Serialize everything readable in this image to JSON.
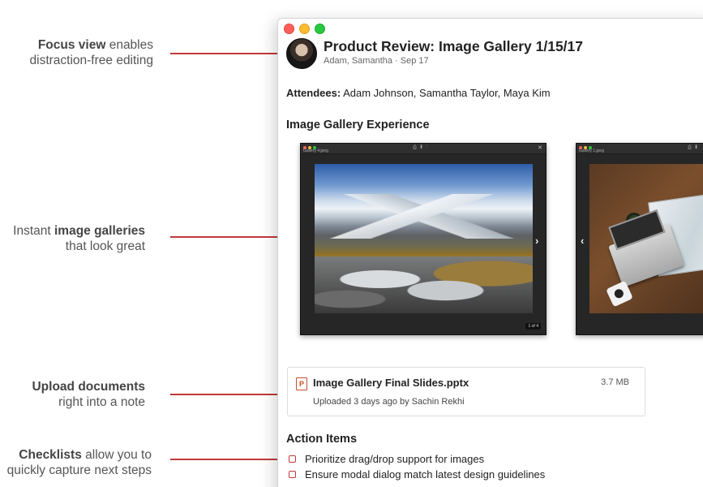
{
  "callouts": [
    {
      "bold": "Focus view",
      "rest1": " enables",
      "line2": "distraction-free editing"
    },
    {
      "pre": "Instant ",
      "bold": "image galleries",
      "line2": "that look great"
    },
    {
      "bold": "Upload documents",
      "line2": "right into a note"
    },
    {
      "bold": "Checklists",
      "rest1": " allow you to",
      "line2": "quickly capture next steps"
    }
  ],
  "colors": {
    "accent": "#c0393b",
    "traffic_red": "#fc5f57",
    "traffic_yellow": "#fdbc2e",
    "traffic_green": "#28c840"
  },
  "note": {
    "title": "Product Review: Image Gallery 1/15/17",
    "meta": "Adam, Samantha · Sep 17",
    "attendees_label": "Attendees:",
    "attendees_value": " Adam Johnson, Samantha Taylor, Maya Kim"
  },
  "gallery": {
    "heading": "Image Gallery Experience",
    "frames": [
      {
        "name": "Gallery 4.jpeg",
        "counter": "1 of 4"
      },
      {
        "name": "Gallery 1.jpeg"
      }
    ]
  },
  "attachment": {
    "icon_letter": "P",
    "name": "Image Gallery Final Slides.pptx",
    "size": "3.7 MB",
    "meta": "Uploaded 3 days ago by Sachin Rekhi"
  },
  "action_items": {
    "heading": "Action Items",
    "items": [
      {
        "text": "Prioritize drag/drop support for images",
        "checked": false
      },
      {
        "text": "Ensure modal dialog match latest design guidelines",
        "checked": false
      }
    ]
  }
}
